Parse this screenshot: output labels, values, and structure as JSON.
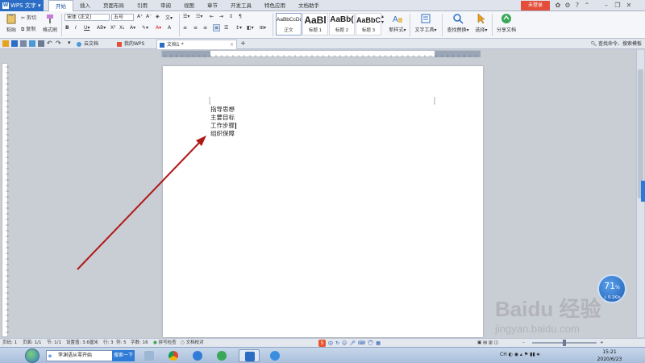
{
  "app": {
    "name": "WPS 文字",
    "login": "未登录"
  },
  "menu": {
    "tabs": [
      "开始",
      "插入",
      "页面布局",
      "引用",
      "审阅",
      "视图",
      "章节",
      "开发工具",
      "特色应用",
      "文档助手"
    ],
    "active_tab": "开始"
  },
  "ribbon": {
    "paste": "粘贴",
    "cut": "剪切",
    "copy": "复制",
    "format_painter": "格式刷",
    "font_name": "宋体 (正文)",
    "font_size": "五号",
    "styles": [
      {
        "sample": "AaBbCcDd",
        "name": "正文"
      },
      {
        "sample": "AaBl",
        "name": "标题 1"
      },
      {
        "sample": "AaBb(",
        "name": "标题 2"
      },
      {
        "sample": "AaBbC",
        "name": "标题 3"
      }
    ],
    "new_style": "新样式",
    "text_tools": "文字工具",
    "find_replace": "查找替换",
    "select": "选择",
    "share_doc": "分享文档"
  },
  "tabbar": {
    "tabs": [
      {
        "label": "云文档",
        "active": false
      },
      {
        "label": "我的WPS",
        "active": false
      },
      {
        "label": "文档1 *",
        "active": true
      }
    ],
    "add": "+",
    "search": "查找命令、搜索模板"
  },
  "document": {
    "lines": [
      "指导思想",
      "主要目标",
      "工作步骤",
      "组织保障"
    ]
  },
  "status": {
    "page": "页码: 1",
    "pages": "页面: 1/1",
    "section": "节: 1/1",
    "setting": "设置值: 3.6厘米",
    "row": "行: 3",
    "col": "列: 5",
    "words": "字数: 16",
    "spellcheck": "拼写检查",
    "proofread": "文档校对"
  },
  "ime": {
    "logo": "S",
    "mode": "中"
  },
  "speed": {
    "percent": "71",
    "unit": "%",
    "rate": "↓ 0.1K/s"
  },
  "taskbar": {
    "search_text": "李渊语从零开始",
    "search_button": "搜索一下",
    "lang": "CH",
    "time": "15:21",
    "date": "2020/6/23"
  },
  "watermark": {
    "text": "Baidu 经验",
    "url": "jingyan.baidu.com"
  },
  "colors": {
    "accent": "#2b6cc4",
    "arrow": "#b01818",
    "login": "#e44d3a"
  }
}
